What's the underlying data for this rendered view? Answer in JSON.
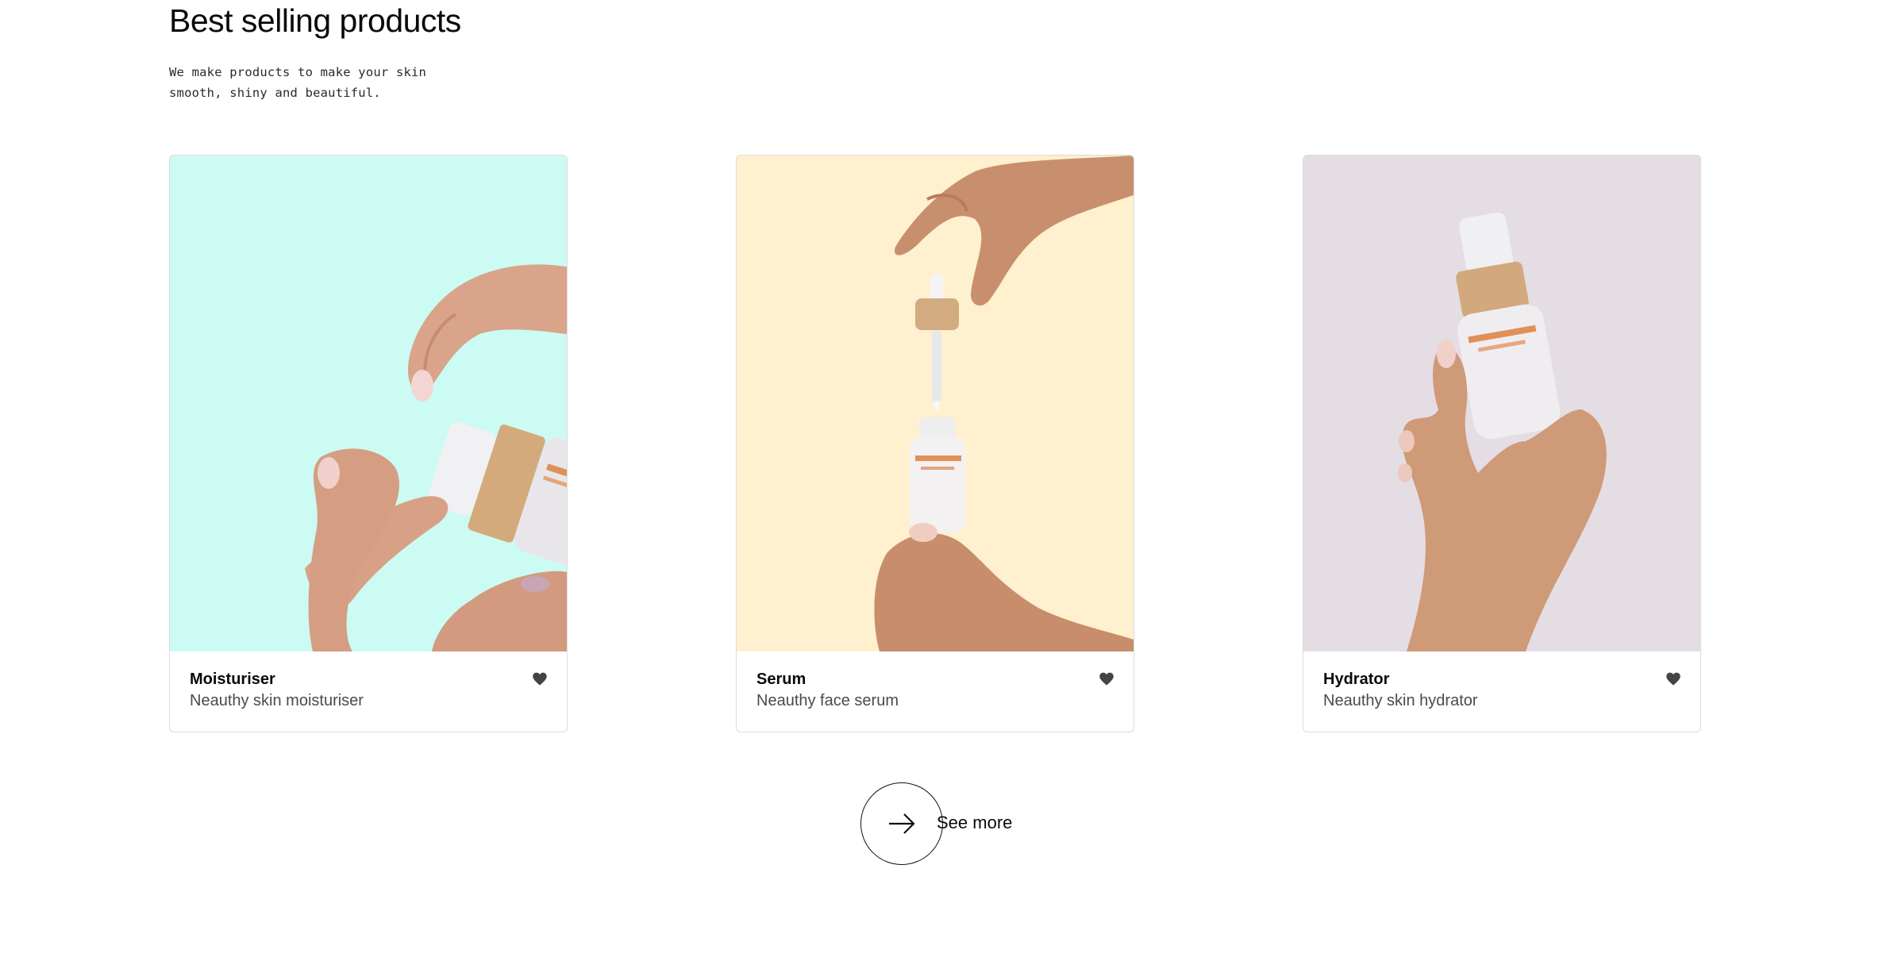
{
  "section": {
    "title": "Best selling products",
    "subtitle": "We make products to make your skin smooth, shiny and beautiful."
  },
  "products": [
    {
      "name": "Moisturiser",
      "description": "Neauthy skin moisturiser",
      "image_bg": "#cbfbf2",
      "icon": "heart-icon"
    },
    {
      "name": "Serum",
      "description": "Neauthy face serum",
      "image_bg": "#fff0cf",
      "icon": "heart-icon"
    },
    {
      "name": "Hydrator",
      "description": "Neauthy skin hydrator",
      "image_bg": "#e4dde4",
      "icon": "heart-icon"
    }
  ],
  "see_more": {
    "label": "See more",
    "icon": "arrow-right-icon"
  },
  "colors": {
    "text": "#0a0a0a",
    "muted": "#4a4a4a",
    "border": "#dcdcdc",
    "heart": "#444444"
  }
}
